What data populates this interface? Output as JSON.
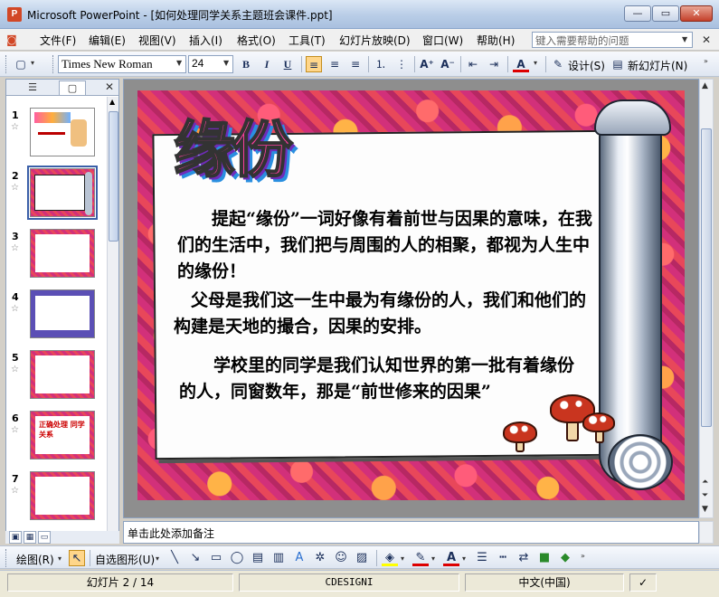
{
  "window": {
    "app_icon_text": "P",
    "title": "Microsoft PowerPoint - [如何处理同学关系主题班会课件.ppt]",
    "minimize": "—",
    "restore": "▭",
    "close": "✕"
  },
  "menu": {
    "items": [
      "文件(F)",
      "编辑(E)",
      "视图(V)",
      "插入(I)",
      "格式(O)",
      "工具(T)",
      "幻灯片放映(D)",
      "窗口(W)",
      "帮助(H)"
    ],
    "help_placeholder": "键入需要帮助的问题",
    "doc_close": "✕"
  },
  "toolbar": {
    "font_name": "Times New Roman",
    "font_size": "24",
    "bold": "B",
    "italic": "I",
    "underline": "U",
    "design_label": "设计(S)",
    "new_slide_label": "新幻灯片(N)"
  },
  "left_panel": {
    "tab_outline": "☰",
    "tab_slides": "▢",
    "close": "✕",
    "thumbnails": [
      {
        "num": "1",
        "selected": false
      },
      {
        "num": "2",
        "selected": true
      },
      {
        "num": "3",
        "selected": false
      },
      {
        "num": "4",
        "selected": false
      },
      {
        "num": "5",
        "selected": false
      },
      {
        "num": "6",
        "selected": false
      },
      {
        "num": "7",
        "selected": false
      }
    ],
    "thumb6_text": "正确处理 同学关系"
  },
  "slide": {
    "title": "缘份",
    "para1": "　　提起“缘份”一词好像有着前世与因果的意味，在我们的生活中，我们把与周围的人的相聚，都视为人生中的缘份！",
    "para2": "　父母是我们这一生中最为有缘份的人，我们和他们的构建是天地的撮合，因果的安排。",
    "para3": "　　学校里的同学是我们认知世界的第一批有着缘份的人，同窗数年，那是“前世修来的因果”"
  },
  "notes": {
    "placeholder": "单击此处添加备注"
  },
  "drawbar": {
    "draw_label": "绘图(R)",
    "autoshapes_label": "自选图形(U)"
  },
  "status": {
    "slide_info": "幻灯片 2 / 14",
    "design_name": "CDESIGNI",
    "language": "中文(中国)"
  }
}
